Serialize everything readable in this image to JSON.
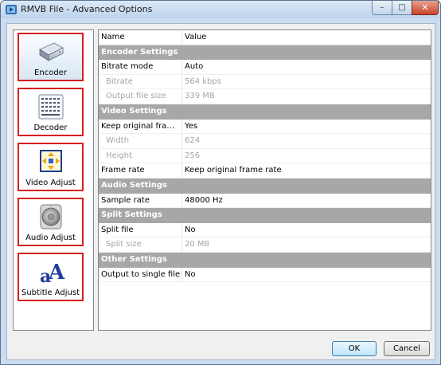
{
  "window": {
    "title": "RMVB File - Advanced Options",
    "controls": {
      "minimize": "–",
      "maximize": "□",
      "close": "✕"
    }
  },
  "nav": {
    "items": [
      {
        "label": "Encoder",
        "icon": "encoder-drive-icon",
        "active": true
      },
      {
        "label": "Decoder",
        "icon": "decoder-grid-icon",
        "active": false
      },
      {
        "label": "Video Adjust",
        "icon": "video-adjust-icon",
        "active": false
      },
      {
        "label": "Audio Adjust",
        "icon": "speaker-icon",
        "active": false
      },
      {
        "label": "Subtitle Adjust",
        "icon": "subtitle-font-icon",
        "active": false
      }
    ]
  },
  "grid": {
    "columns": {
      "name": "Name",
      "value": "Value"
    },
    "sections": [
      {
        "title": "Encoder Settings",
        "rows": [
          {
            "name": "Bitrate mode",
            "value": "Auto",
            "disabled": false
          },
          {
            "name": "Bitrate",
            "value": "564 kbps",
            "disabled": true
          },
          {
            "name": "Output file size",
            "value": "339 MB",
            "disabled": true
          }
        ]
      },
      {
        "title": "Video Settings",
        "rows": [
          {
            "name": "Keep original fram...",
            "value": "Yes",
            "disabled": false
          },
          {
            "name": "Width",
            "value": "624",
            "disabled": true
          },
          {
            "name": "Height",
            "value": "256",
            "disabled": true
          },
          {
            "name": "Frame rate",
            "value": "Keep original frame rate",
            "disabled": false
          }
        ]
      },
      {
        "title": "Audio Settings",
        "rows": [
          {
            "name": "Sample rate",
            "value": "48000 Hz",
            "disabled": false
          }
        ]
      },
      {
        "title": "Split Settings",
        "rows": [
          {
            "name": "Split file",
            "value": "No",
            "disabled": false
          },
          {
            "name": "Split size",
            "value": "20 MB",
            "disabled": true
          }
        ]
      },
      {
        "title": "Other Settings",
        "rows": [
          {
            "name": "Output to single file",
            "value": "No",
            "disabled": false
          }
        ]
      }
    ]
  },
  "buttons": {
    "ok": "OK",
    "cancel": "Cancel"
  }
}
